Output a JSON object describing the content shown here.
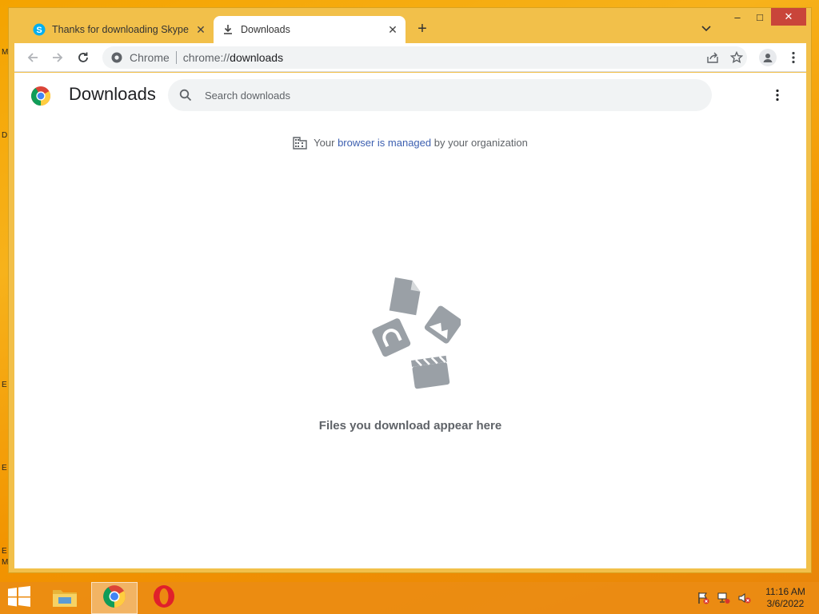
{
  "window": {
    "tabs": [
      {
        "title": "Thanks for downloading Skype",
        "icon": "skype-icon",
        "active": false
      },
      {
        "title": "Downloads",
        "icon": "download-icon",
        "active": true
      }
    ],
    "controls": {
      "minimize": "–",
      "maximize": "□",
      "close": "✕"
    }
  },
  "toolbar": {
    "origin_label": "Chrome",
    "url_scheme": "chrome://",
    "url_path": "downloads"
  },
  "downloads": {
    "title": "Downloads",
    "search_placeholder": "Search downloads",
    "managed": {
      "prefix": "Your ",
      "link": "browser is managed",
      "suffix": " by your organization"
    },
    "empty_message": "Files you download appear here"
  },
  "taskbar": {
    "apps": [
      "start-icon",
      "file-explorer-icon",
      "chrome-icon",
      "opera-icon"
    ],
    "clock_time": "11:16 AM",
    "clock_date": "3/6/2022"
  },
  "desktop": {
    "edge_letters": [
      "M",
      "D",
      "E",
      "E",
      "E",
      "M"
    ]
  },
  "colors": {
    "accent_link": "#3c5fb0",
    "window_frame": "#f2c04a",
    "close_button": "#c9453a"
  }
}
